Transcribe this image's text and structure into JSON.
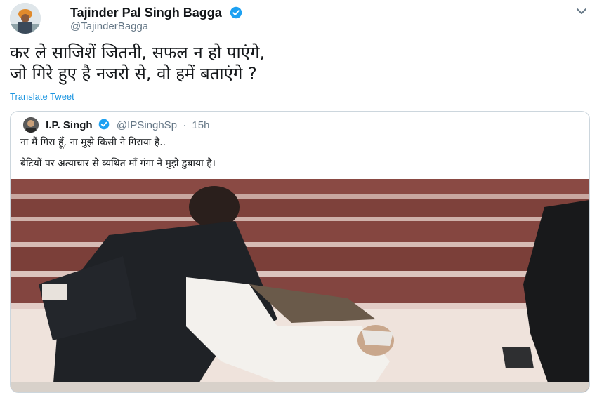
{
  "tweet": {
    "author_name": "Tajinder Pal Singh Bagga",
    "author_handle": "@TajinderBagga",
    "text_line1": "कर ले साजिशें जितनी, सफल न हो पाएंगे,",
    "text_line2": "जो गिरे हुए है नजरो से, वो हमें बताएंगे ?",
    "translate_label": "Translate Tweet",
    "verified": true
  },
  "quoted_tweet": {
    "author_name": "I.P. Singh",
    "author_handle": "@IPSinghSp",
    "separator": "·",
    "time": "15h",
    "line1": "ना मैं गिरा हूँ, ना मुझे किसी ने गिराया है..",
    "line2": "बेटियों पर अत्याचार से व्यथित माँ गंगा ने मुझे डुबाया है।",
    "verified": true
  },
  "colors": {
    "verified_blue": "#1da1f2",
    "link_blue": "#1b95e0",
    "secondary_text": "#657786",
    "border": "#ccd6dd"
  },
  "icons": {
    "verified": "verified-badge-icon",
    "menu": "chevron-down-icon"
  }
}
